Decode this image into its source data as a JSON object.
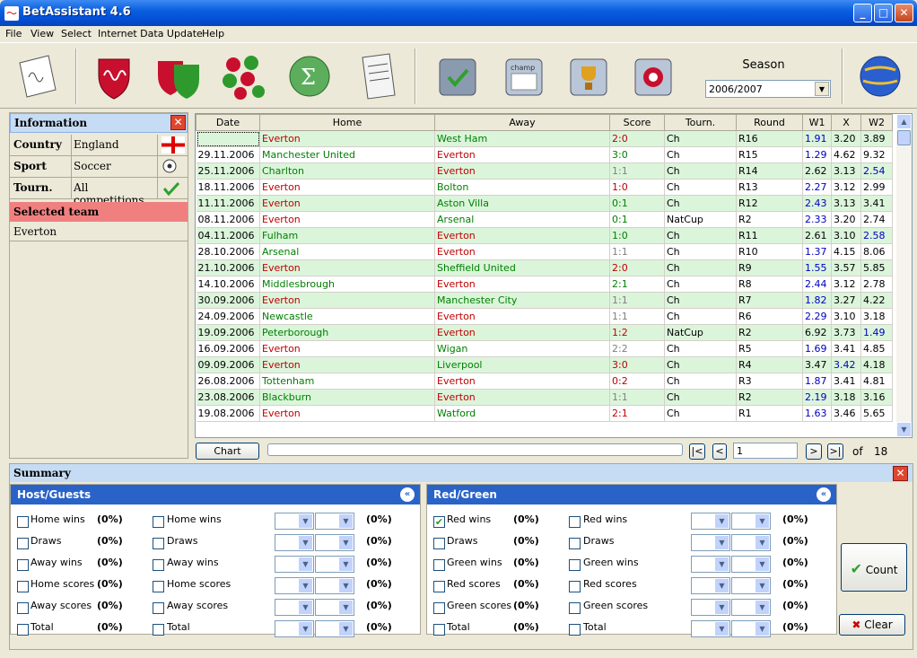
{
  "window": {
    "title": "BetAssistant 4.6"
  },
  "menu": [
    "File",
    "View",
    "Select",
    "Internet Data Update",
    "Help"
  ],
  "season": {
    "label": "Season",
    "value": "2006/2007"
  },
  "info": {
    "header": "Information",
    "country_label": "Country",
    "country": "England",
    "sport_label": "Sport",
    "sport": "Soccer",
    "tourn_label": "Tourn.",
    "tourn": "All competitions",
    "selected_header": "Selected team",
    "selected_team": "Everton"
  },
  "grid": {
    "columns": [
      "Date",
      "Home",
      "Away",
      "Score",
      "Tourn.",
      "Round",
      "W1",
      "X",
      "W2"
    ],
    "rows": [
      [
        "",
        "Everton",
        "West Ham",
        "2:0",
        "Ch",
        "R16",
        "1.91",
        "3.20",
        "3.89"
      ],
      [
        "29.11.2006",
        "Manchester United",
        "Everton",
        "3:0",
        "Ch",
        "R15",
        "1.29",
        "4.62",
        "9.32"
      ],
      [
        "25.11.2006",
        "Charlton",
        "Everton",
        "1:1",
        "Ch",
        "R14",
        "2.62",
        "3.13",
        "2.54"
      ],
      [
        "18.11.2006",
        "Everton",
        "Bolton",
        "1:0",
        "Ch",
        "R13",
        "2.27",
        "3.12",
        "2.99"
      ],
      [
        "11.11.2006",
        "Everton",
        "Aston Villa",
        "0:1",
        "Ch",
        "R12",
        "2.43",
        "3.13",
        "3.41"
      ],
      [
        "08.11.2006",
        "Everton",
        "Arsenal",
        "0:1",
        "NatCup",
        "R2",
        "2.33",
        "3.20",
        "2.74"
      ],
      [
        "04.11.2006",
        "Fulham",
        "Everton",
        "1:0",
        "Ch",
        "R11",
        "2.61",
        "3.10",
        "2.58"
      ],
      [
        "28.10.2006",
        "Arsenal",
        "Everton",
        "1:1",
        "Ch",
        "R10",
        "1.37",
        "4.15",
        "8.06"
      ],
      [
        "21.10.2006",
        "Everton",
        "Sheffield United",
        "2:0",
        "Ch",
        "R9",
        "1.55",
        "3.57",
        "5.85"
      ],
      [
        "14.10.2006",
        "Middlesbrough",
        "Everton",
        "2:1",
        "Ch",
        "R8",
        "2.44",
        "3.12",
        "2.78"
      ],
      [
        "30.09.2006",
        "Everton",
        "Manchester City",
        "1:1",
        "Ch",
        "R7",
        "1.82",
        "3.27",
        "4.22"
      ],
      [
        "24.09.2006",
        "Newcastle",
        "Everton",
        "1:1",
        "Ch",
        "R6",
        "2.29",
        "3.10",
        "3.18"
      ],
      [
        "19.09.2006",
        "Peterborough",
        "Everton",
        "1:2",
        "NatCup",
        "R2",
        "6.92",
        "3.73",
        "1.49"
      ],
      [
        "16.09.2006",
        "Everton",
        "Wigan",
        "2:2",
        "Ch",
        "R5",
        "1.69",
        "3.41",
        "4.85"
      ],
      [
        "09.09.2006",
        "Everton",
        "Liverpool",
        "3:0",
        "Ch",
        "R4",
        "3.47",
        "3.42",
        "4.18"
      ],
      [
        "26.08.2006",
        "Tottenham",
        "Everton",
        "0:2",
        "Ch",
        "R3",
        "1.87",
        "3.41",
        "4.81"
      ],
      [
        "23.08.2006",
        "Blackburn",
        "Everton",
        "1:1",
        "Ch",
        "R2",
        "2.19",
        "3.18",
        "3.16"
      ],
      [
        "19.08.2006",
        "Everton",
        "Watford",
        "2:1",
        "Ch",
        "R1",
        "1.63",
        "3.46",
        "5.65"
      ]
    ]
  },
  "nav": {
    "chart_label": "Chart",
    "page": "1",
    "of_label": "of",
    "total": "18"
  },
  "summary": {
    "header": "Summary",
    "host": {
      "title": "Host/Guests",
      "left": [
        "Home wins",
        "Draws",
        "Away wins",
        "Home scores",
        "Away scores",
        "Total"
      ],
      "right": [
        "Home wins",
        "Draws",
        "Away wins",
        "Home scores",
        "Away scores",
        "Total"
      ],
      "pct": "(0%)"
    },
    "red": {
      "title": "Red/Green",
      "left": [
        "Red wins",
        "Draws",
        "Green wins",
        "Red scores",
        "Green scores",
        "Total"
      ],
      "right": [
        "Red wins",
        "Draws",
        "Green wins",
        "Red scores",
        "Green scores",
        "Total"
      ],
      "pct": "(0%)"
    },
    "count_label": "Count",
    "clear_label": "Clear"
  }
}
